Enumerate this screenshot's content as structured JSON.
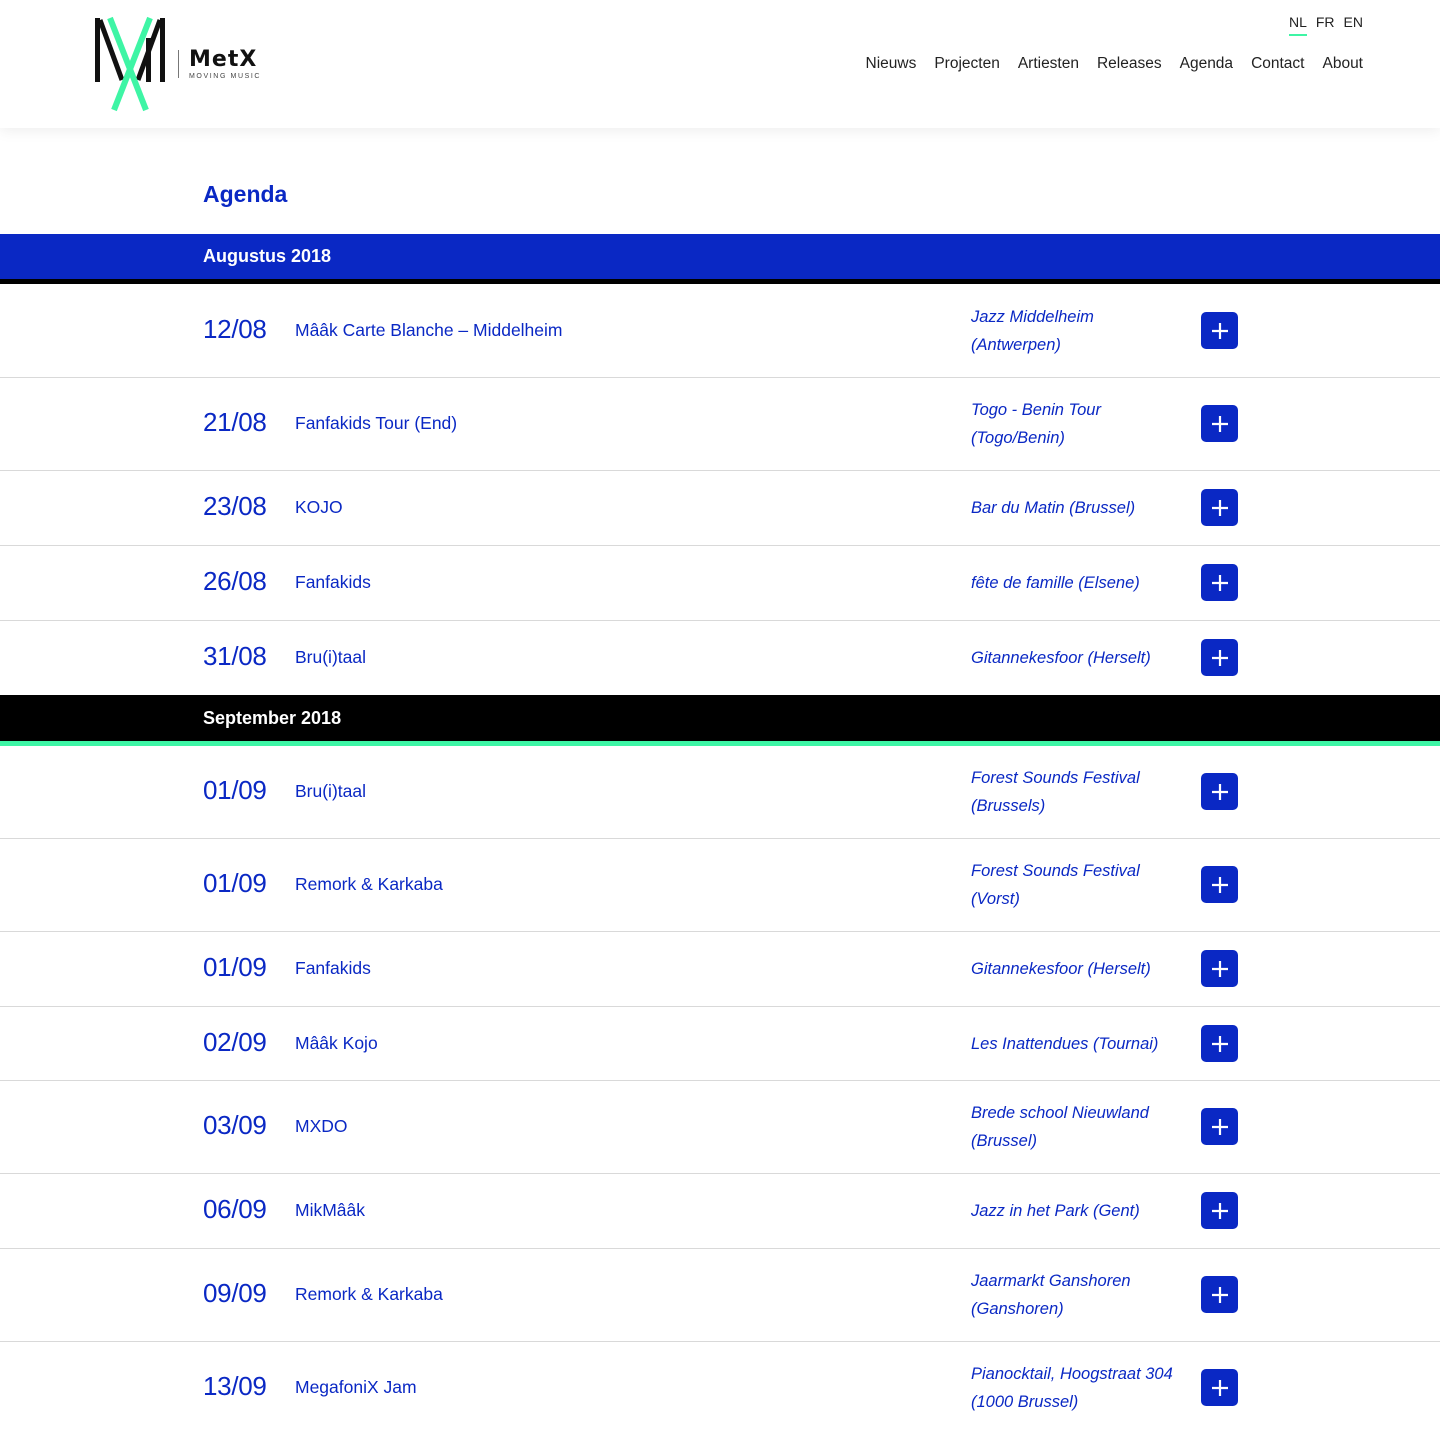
{
  "brand": {
    "name": "MetX",
    "tagline": "MOVING MUSIC"
  },
  "languages": [
    "NL",
    "FR",
    "EN"
  ],
  "active_language": "NL",
  "nav": [
    "Nieuws",
    "Projecten",
    "Artiesten",
    "Releases",
    "Agenda",
    "Contact",
    "About"
  ],
  "page_title": "Agenda",
  "months": [
    {
      "label": "Augustus 2018",
      "events": [
        {
          "date": "12/08",
          "title": "Mââk Carte Blanche – Middelheim",
          "venue": "Jazz Middelheim (Antwerpen)"
        },
        {
          "date": "21/08",
          "title": "Fanfakids Tour (End)",
          "venue": "Togo - Benin Tour (Togo/Benin)"
        },
        {
          "date": "23/08",
          "title": "KOJO",
          "venue": "Bar du Matin (Brussel)"
        },
        {
          "date": "26/08",
          "title": "Fanfakids",
          "venue": "fête de famille (Elsene)"
        },
        {
          "date": "31/08",
          "title": "Bru(i)taal",
          "venue": "Gitannekesfoor (Herselt)"
        }
      ]
    },
    {
      "label": "September 2018",
      "events": [
        {
          "date": "01/09",
          "title": "Bru(i)taal",
          "venue": "Forest Sounds Festival (Brussels)"
        },
        {
          "date": "01/09",
          "title": "Remork & Karkaba",
          "venue": "Forest Sounds Festival (Vorst)"
        },
        {
          "date": "01/09",
          "title": "Fanfakids",
          "venue": "Gitannekesfoor (Herselt)"
        },
        {
          "date": "02/09",
          "title": "Mââk Kojo",
          "venue": "Les Inattendues (Tournai)"
        },
        {
          "date": "03/09",
          "title": "MXDO",
          "venue": "Brede school Nieuwland (Brussel)"
        },
        {
          "date": "06/09",
          "title": "MikMââk",
          "venue": "Jazz in het Park (Gent)"
        },
        {
          "date": "09/09",
          "title": "Remork & Karkaba",
          "venue": "Jaarmarkt Ganshoren (Ganshoren)"
        },
        {
          "date": "13/09",
          "title": "MegafoniX Jam",
          "venue": "Pianocktail, Hoogstraat 304 (1000 Brussel)"
        }
      ]
    }
  ],
  "colors": {
    "primary": "#0a28c4",
    "accent": "#3ef5a5",
    "black": "#000000"
  },
  "icons": {
    "expand": "plus-icon"
  }
}
